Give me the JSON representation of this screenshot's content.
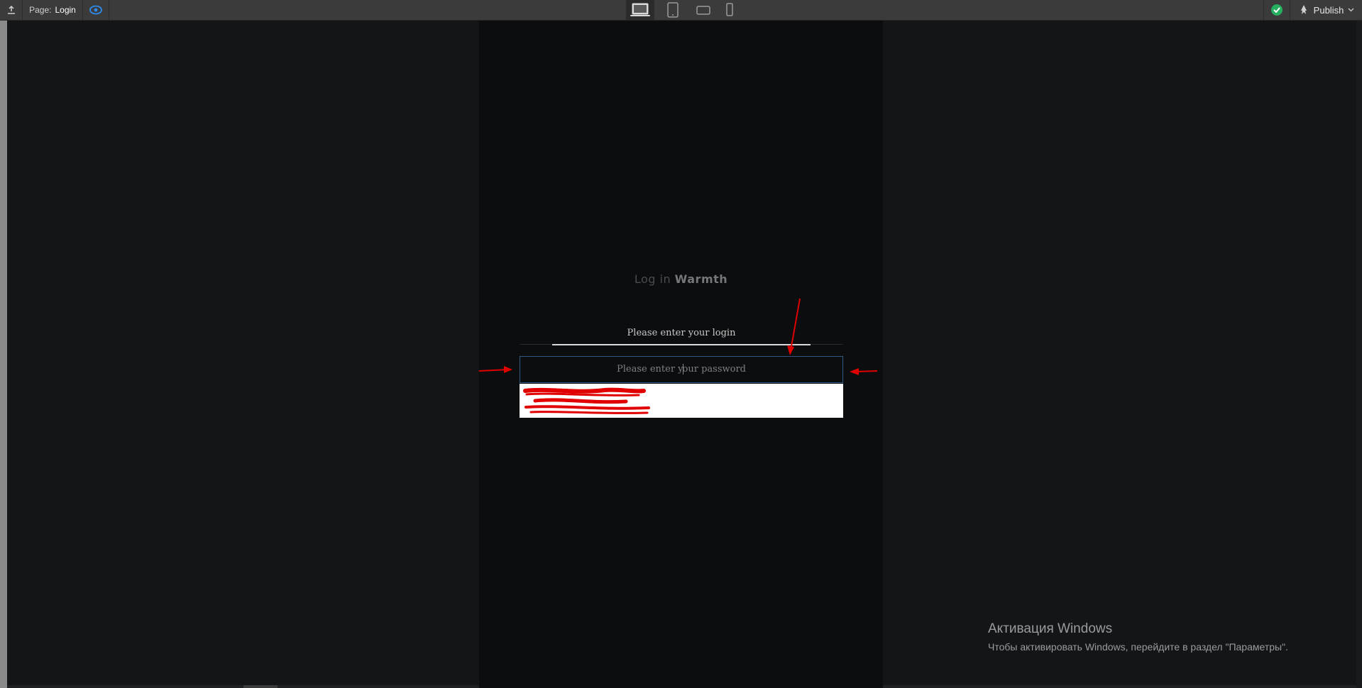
{
  "toolbar": {
    "page_prefix": "Page:",
    "page_name": "Login",
    "publish_label": "Publish",
    "devices": [
      "desktop-icon",
      "tablet-icon",
      "mobile-landscape-icon",
      "mobile-portrait-icon"
    ],
    "active_device": "desktop",
    "status": "published-ok"
  },
  "login_page": {
    "title_part1": "Log in",
    "title_part2": "Warmth",
    "login_placeholder": "Please enter your login",
    "password_placeholder_before_caret": "Please enter y",
    "password_placeholder_after_caret": "our password"
  },
  "windows_watermark": {
    "title": "Активация Windows",
    "subtitle": "Чтобы активировать Windows, перейдите в раздел \"Параметры\"."
  },
  "colors": {
    "annotation_red": "#e00000",
    "focus_border": "#2f5a86",
    "check_green": "#27ae60",
    "preview_blue": "#2d8cf0"
  }
}
